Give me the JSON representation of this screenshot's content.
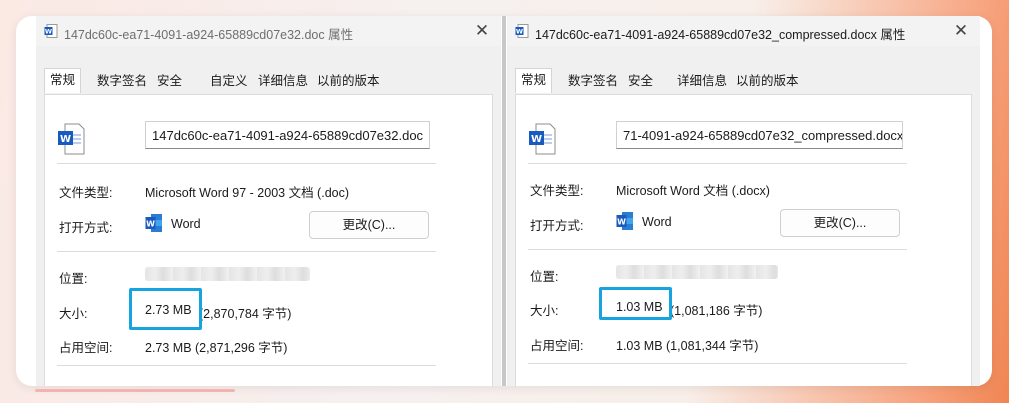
{
  "left_dialog": {
    "title": "147dc60c-ea71-4091-a924-65889cd07e32.doc 属性",
    "tabs": [
      "常规",
      "数字签名",
      "安全",
      "自定义",
      "详细信息",
      "以前的版本"
    ],
    "filename": "147dc60c-ea71-4091-a924-65889cd07e32.doc",
    "file_type_label": "文件类型:",
    "file_type_value": "Microsoft Word 97 - 2003 文档 (.doc)",
    "open_with_label": "打开方式:",
    "open_with_app": "Word",
    "change_button": "更改(C)...",
    "location_label": "位置:",
    "size_label": "大小:",
    "size_value": "2.73 MB",
    "size_bytes": "(2,870,784 字节)",
    "disk_label": "占用空间:",
    "disk_value": "2.73 MB (2,871,296 字节)"
  },
  "right_dialog": {
    "title": "147dc60c-ea71-4091-a924-65889cd07e32_compressed.docx 属性",
    "tabs": [
      "常规",
      "数字签名",
      "安全",
      "详细信息",
      "以前的版本"
    ],
    "filename": "71-4091-a924-65889cd07e32_compressed.docx",
    "file_type_label": "文件类型:",
    "file_type_value": "Microsoft Word 文档 (.docx)",
    "open_with_label": "打开方式:",
    "open_with_app": "Word",
    "change_button": "更改(C)...",
    "location_label": "位置:",
    "size_label": "大小:",
    "size_value": "1.03 MB",
    "size_bytes": "(1,081,186 字节)",
    "disk_label": "占用空间:",
    "disk_value": "1.03 MB (1,081,344 字节)"
  },
  "icons": {
    "close": "close-icon",
    "word": "word-icon"
  },
  "colors": {
    "highlight": "#17a3df",
    "word_blue": "#185abd",
    "background_accent": "#f08552"
  }
}
